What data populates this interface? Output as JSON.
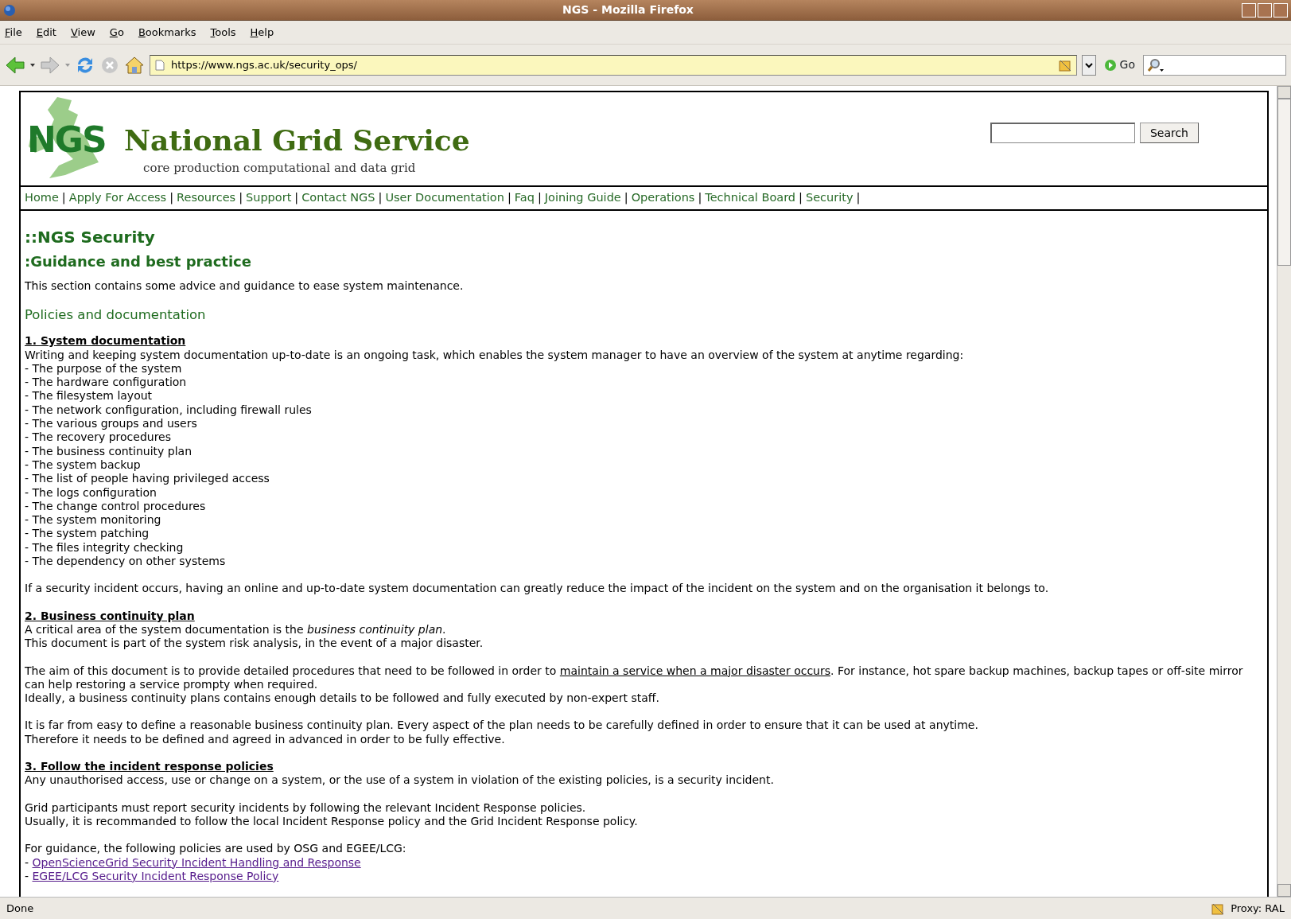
{
  "window": {
    "title": "NGS - Mozilla Firefox"
  },
  "menu": [
    "File",
    "Edit",
    "View",
    "Go",
    "Bookmarks",
    "Tools",
    "Help"
  ],
  "toolbar": {
    "url": "https://www.ngs.ac.uk/security_ops/",
    "go_label": "Go"
  },
  "site": {
    "logo_text": "NGS",
    "title": "National Grid Service",
    "tagline": "core production computational and data grid",
    "search_button": "Search"
  },
  "nav": {
    "separator": "|",
    "items": [
      "Home",
      "Apply For Access",
      "Resources",
      "Support",
      "Contact NGS",
      "User Documentation",
      "Faq",
      "Joining Guide",
      "Operations",
      "Technical Board",
      "Security"
    ]
  },
  "content": [
    {
      "kind": "h1",
      "text": "::NGS Security"
    },
    {
      "kind": "h2",
      "text": ":Guidance and best practice"
    },
    {
      "kind": "p",
      "lines": [
        "This section contains some advice and guidance to ease system maintenance."
      ]
    },
    {
      "kind": "h3",
      "text": "Policies and documentation"
    },
    {
      "kind": "p",
      "title": "1. System documentation",
      "lines": [
        "Writing and keeping system documentation up-to-date is an ongoing task, which enables the system manager to have an overview of the system at anytime regarding:",
        "- The purpose of the system",
        "- The hardware configuration",
        "- The filesystem layout",
        "- The network configuration, including firewall rules",
        "- The various groups and users",
        "- The recovery procedures",
        "- The business continuity plan",
        "- The system backup",
        "- The list of people having privileged access",
        "- The logs configuration",
        "- The change control procedures",
        "- The system monitoring",
        "- The system patching",
        "- The files integrity checking",
        "- The dependency on other systems"
      ]
    },
    {
      "kind": "p",
      "lines": [
        "If a security incident occurs, having an online and up-to-date system documentation can greatly reduce the impact of the incident on the system and on the organisation it belongs to."
      ]
    },
    {
      "kind": "p",
      "title": "2. Business continuity plan",
      "lines": [
        "A critical area of the system documentation is the *business continuity plan*.",
        "This document is part of the system risk analysis, in the event of a major disaster."
      ]
    },
    {
      "kind": "p",
      "lines": [
        [
          {
            "text": "The aim of this document is to provide detailed procedures that need to be followed in order to "
          },
          {
            "text": "maintain a service when a major disaster occurs",
            "link": true
          },
          {
            "text": ". For instance, hot spare backup machines, backup tapes or off-site mirror can help restoring a service prompty when required."
          }
        ],
        "Ideally, a business continuity plans contains enough details to be followed and fully executed by non-expert staff."
      ]
    },
    {
      "kind": "p",
      "lines": [
        "It is far from easy to define a reasonable business continuity plan. Every aspect of the plan needs to be carefully defined in order to ensure that it can be used at anytime.",
        "Therefore it needs to be defined and agreed in advanced in order to be fully effective."
      ]
    },
    {
      "kind": "p",
      "title": "3. Follow the incident response policies",
      "lines": [
        "Any unauthorised access, use or change on a system, or the use of a system in violation of the existing policies, is a security incident."
      ]
    },
    {
      "kind": "p",
      "lines": [
        "Grid participants must report security incidents by following the relevant Incident Response policies.",
        "Usually, it is recommanded to follow the local Incident Response policy and the Grid Incident Response policy."
      ]
    },
    {
      "kind": "p",
      "lines": [
        "For guidance, the following policies are used by OSG and EGEE/LCG:",
        [
          {
            "text": "- "
          },
          {
            "text": "OpenScienceGrid Security Incident Handling and Response",
            "link": true,
            "visited": true
          }
        ],
        [
          {
            "text": "- "
          },
          {
            "text": "EGEE/LCG Security Incident Response Policy",
            "link": true,
            "visited": true
          }
        ]
      ]
    }
  ],
  "status_bar": {
    "text": "Done",
    "proxy": "Proxy: RAL"
  }
}
